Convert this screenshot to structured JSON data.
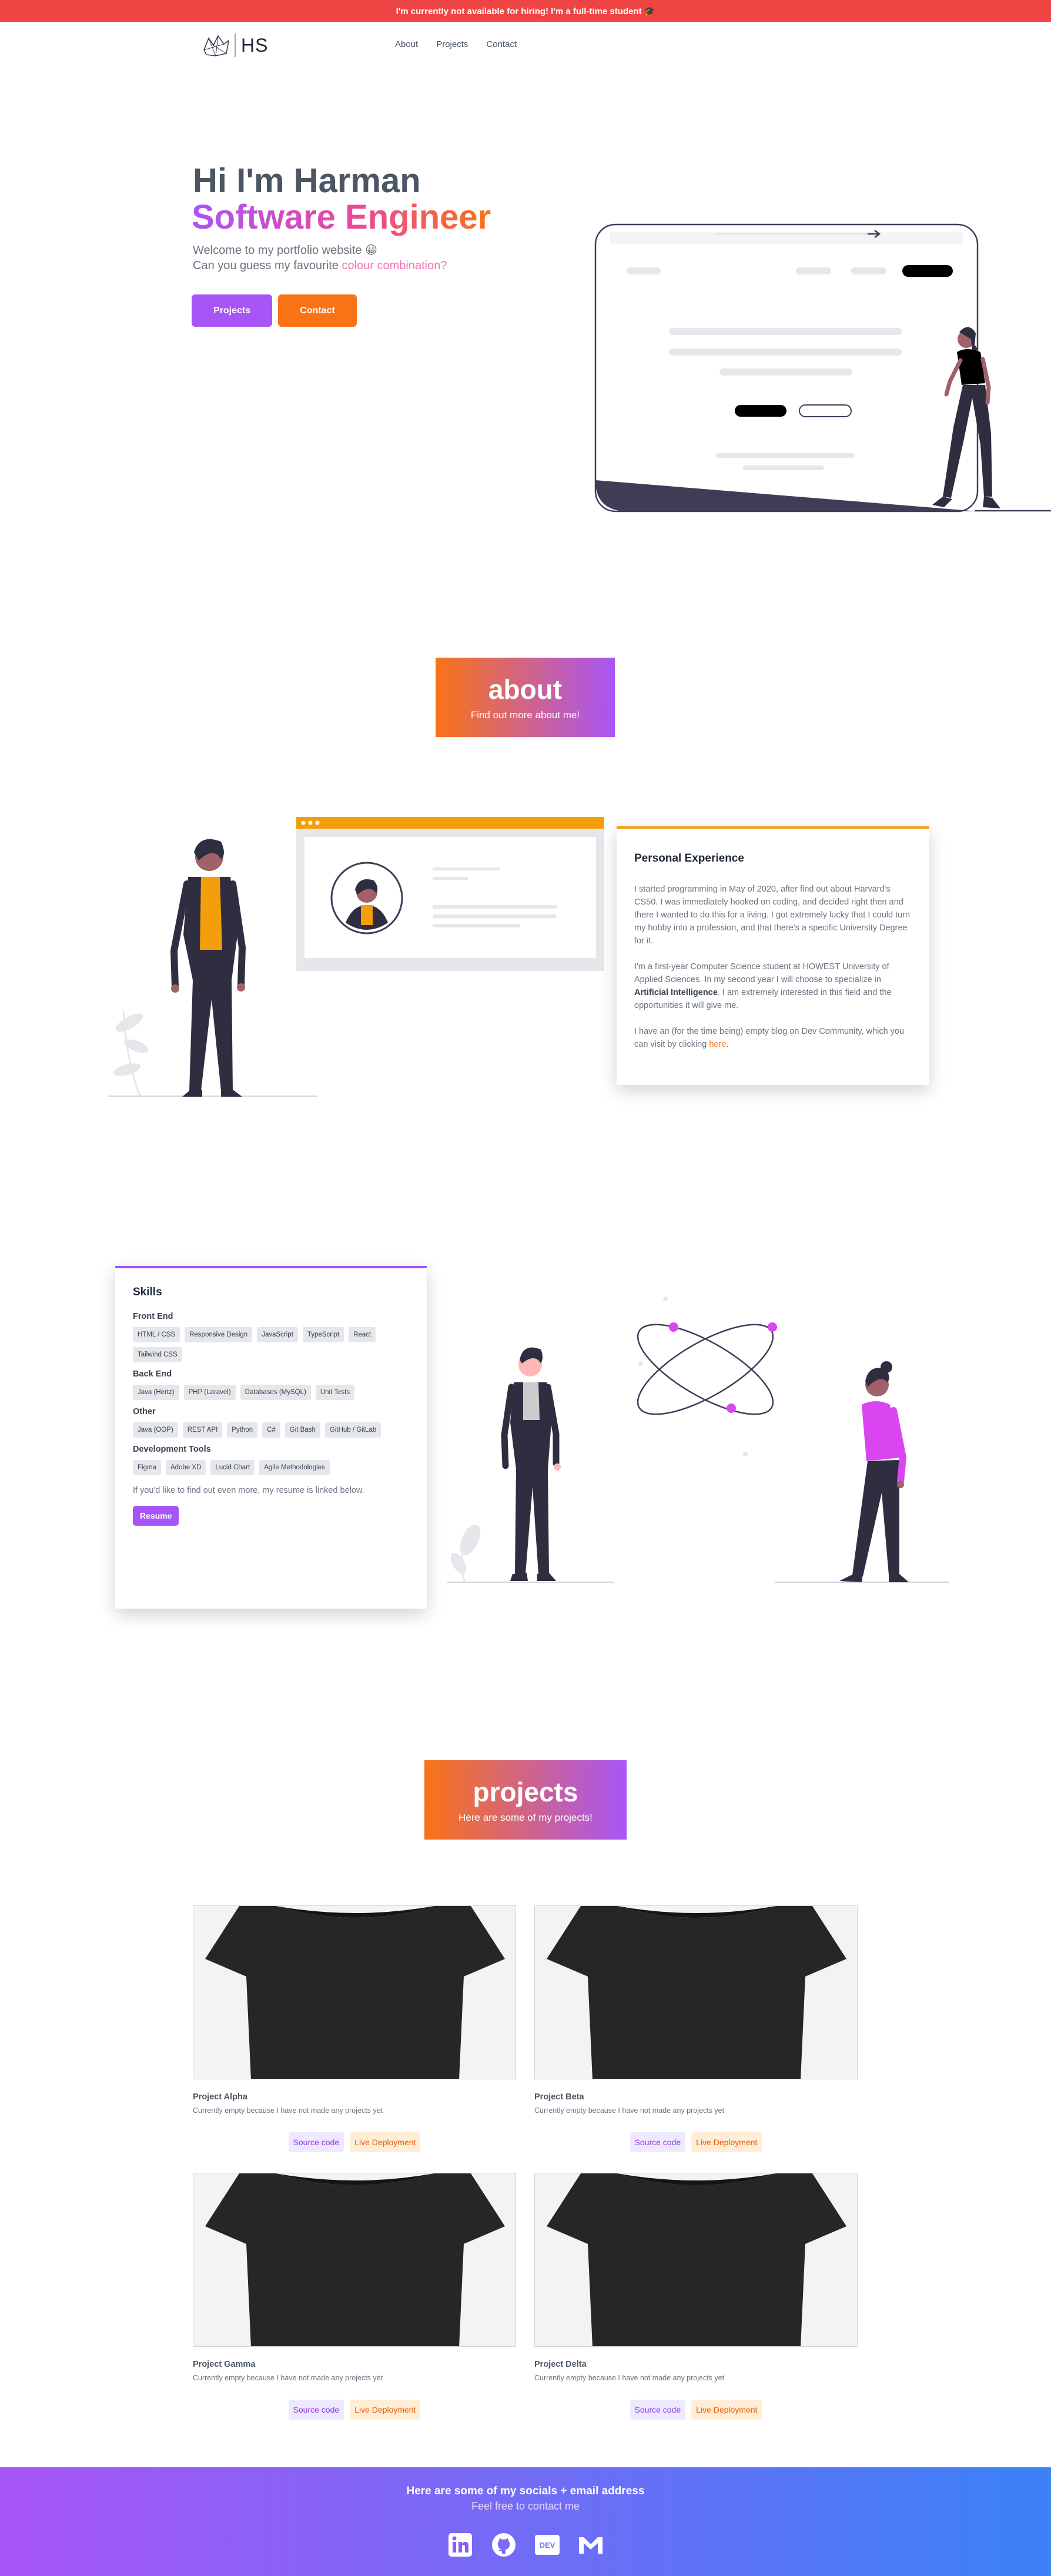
{
  "banner": {
    "text": "I'm currently not available for hiring! I'm a full-time student 🎓"
  },
  "nav": {
    "logo_text": "HS",
    "links": [
      {
        "label": "About"
      },
      {
        "label": "Projects"
      },
      {
        "label": "Contact"
      }
    ]
  },
  "hero": {
    "title_line1": "Hi I'm Harman",
    "title_line2": "Software Engineer",
    "subtitle_line1": "Welcome to my portfolio website 😀",
    "subtitle_line2_prefix": "Can you guess my favourite ",
    "subtitle_line2_accent": "colour combination?",
    "projects_button": "Projects",
    "contact_button": "Contact"
  },
  "about": {
    "heading": "about",
    "subheading": "Find out more about me!",
    "experience": {
      "title": "Personal Experience",
      "p1": "I started programming in May of 2020, after find out about Harvard's CS50. I was immediately hooked on coding, and decided right then and there I wanted to do this for a living. I got extremely lucky that I could turn my hobby into a profession, and that there's a specific University Degree for it.",
      "p2_before": "I'm a first-year Computer Science student at HOWEST University of Applied Sciences. In my second year I will choose to specialize in ",
      "p2_bold": "Artificial Intelligence",
      "p2_after": ". I am extremely interested in this field and the opportunities it will give me.",
      "p3_before": "I have an (for the time being) empty blog on Dev Community, which you can visit by clicking ",
      "p3_link": "here",
      "p3_after": "."
    },
    "skills": {
      "title": "Skills",
      "groups": [
        {
          "name": "Front End",
          "tags": [
            "HTML / CSS",
            "Responsive Design",
            "JavaScript",
            "TypeScript",
            "React",
            "Tailwind CSS"
          ]
        },
        {
          "name": "Back End",
          "tags": [
            "Java (Hertz)",
            "PHP (Laravel)",
            "Databases (MySQL)",
            "Unit Tests"
          ]
        },
        {
          "name": "Other",
          "tags": [
            "Java (OOP)",
            "REST API",
            "Python",
            "C#",
            "Git Bash",
            "GitHub / GitLab"
          ]
        },
        {
          "name": "Development Tools",
          "tags": [
            "Figma",
            "Adobe XD",
            "Lucid Chart",
            "Agile Methodologies"
          ]
        }
      ],
      "note": "If you'd like to find out even more, my resume is linked below.",
      "resume_button": "Resume"
    }
  },
  "projects": {
    "heading": "projects",
    "subheading": "Here are some of my projects!",
    "items": [
      {
        "title": "Project Alpha",
        "desc": "Currently empty because I have not made any projects yet",
        "source": "Source code",
        "live": "Live Deployment"
      },
      {
        "title": "Project Beta",
        "desc": "Currently empty because I have not made any projects yet",
        "source": "Source code",
        "live": "Live Deployment"
      },
      {
        "title": "Project Gamma",
        "desc": "Currently empty because I have not made any projects yet",
        "source": "Source code",
        "live": "Live Deployment"
      },
      {
        "title": "Project Delta",
        "desc": "Currently empty because I have not made any projects yet",
        "source": "Source code",
        "live": "Live Deployment"
      }
    ]
  },
  "footer": {
    "heading": "Here are some of my socials + email address",
    "subheading": "Feel free to contact me",
    "icons": [
      "linkedin-icon",
      "github-icon",
      "dev-icon",
      "gmail-icon"
    ],
    "dev_label": "DEV"
  },
  "colors": {
    "purple": "#a855f7",
    "orange": "#f97316",
    "red": "#ef4444",
    "blue": "#3b82f6"
  }
}
